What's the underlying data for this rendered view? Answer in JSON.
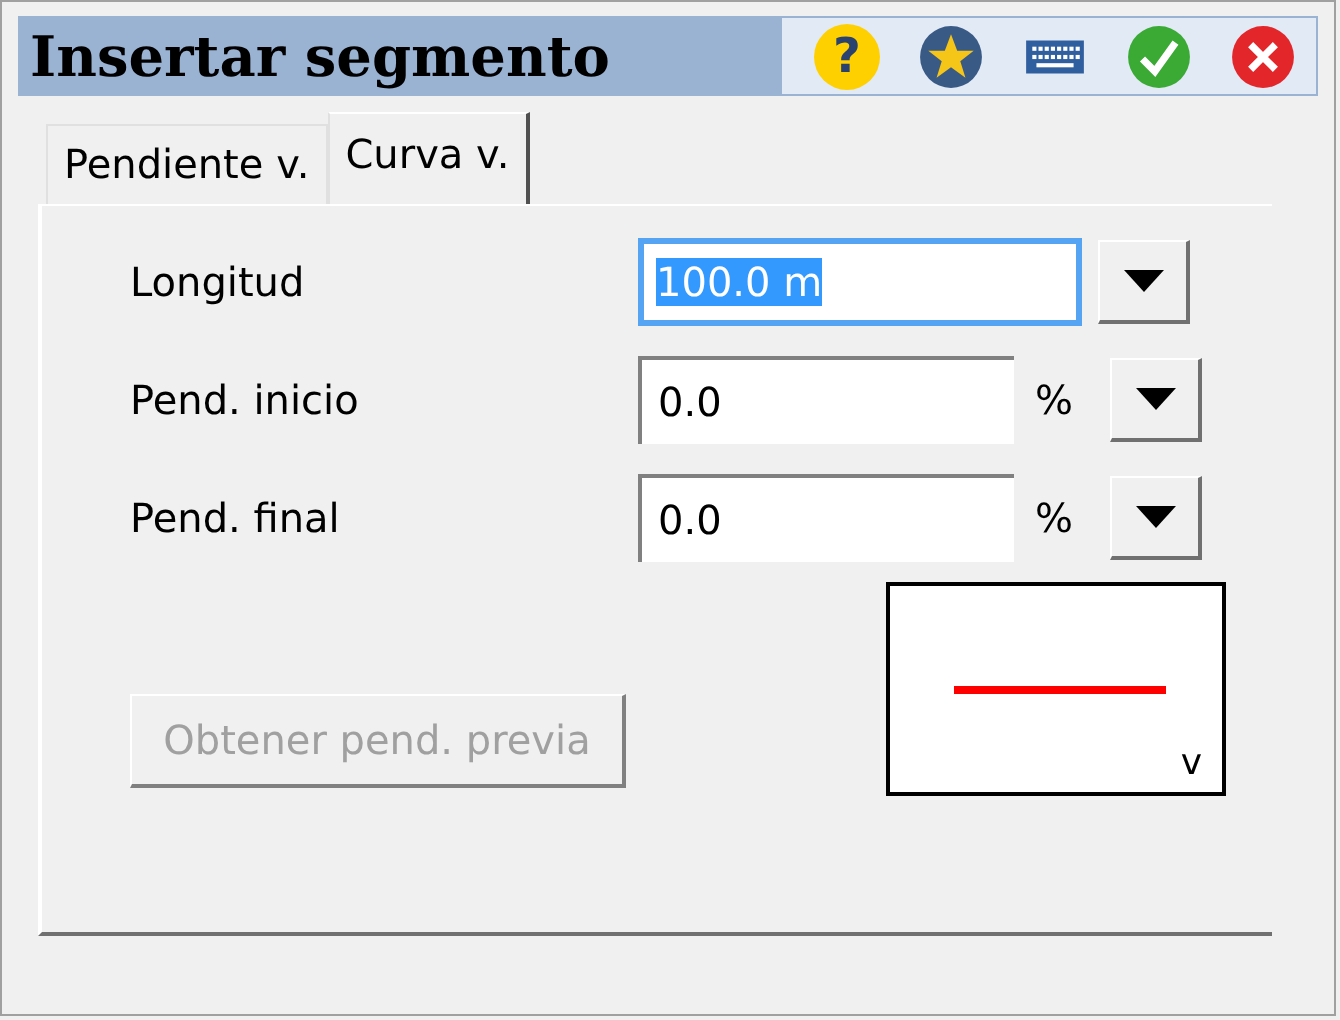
{
  "window": {
    "title": "Insertar segmento"
  },
  "toolbar": [
    {
      "kind": "help",
      "label": "?"
    },
    {
      "kind": "favorite"
    },
    {
      "kind": "keyboard"
    },
    {
      "kind": "ok"
    },
    {
      "kind": "close"
    }
  ],
  "tabs": [
    {
      "label": "Pendiente v.",
      "selected": false
    },
    {
      "label": "Curva v.",
      "selected": true
    }
  ],
  "fields": [
    {
      "label": "Longitud",
      "value": "100.0 m",
      "focused": true
    },
    {
      "label": "Pend. inicio",
      "value": "0.0",
      "unit": "%",
      "focused": false
    },
    {
      "label": "Pend. final",
      "value": "0.0",
      "unit": "%",
      "focused": false
    }
  ],
  "button": {
    "label": "Obtener pend. previa",
    "disabled": true
  },
  "preview": {
    "label": "v"
  }
}
